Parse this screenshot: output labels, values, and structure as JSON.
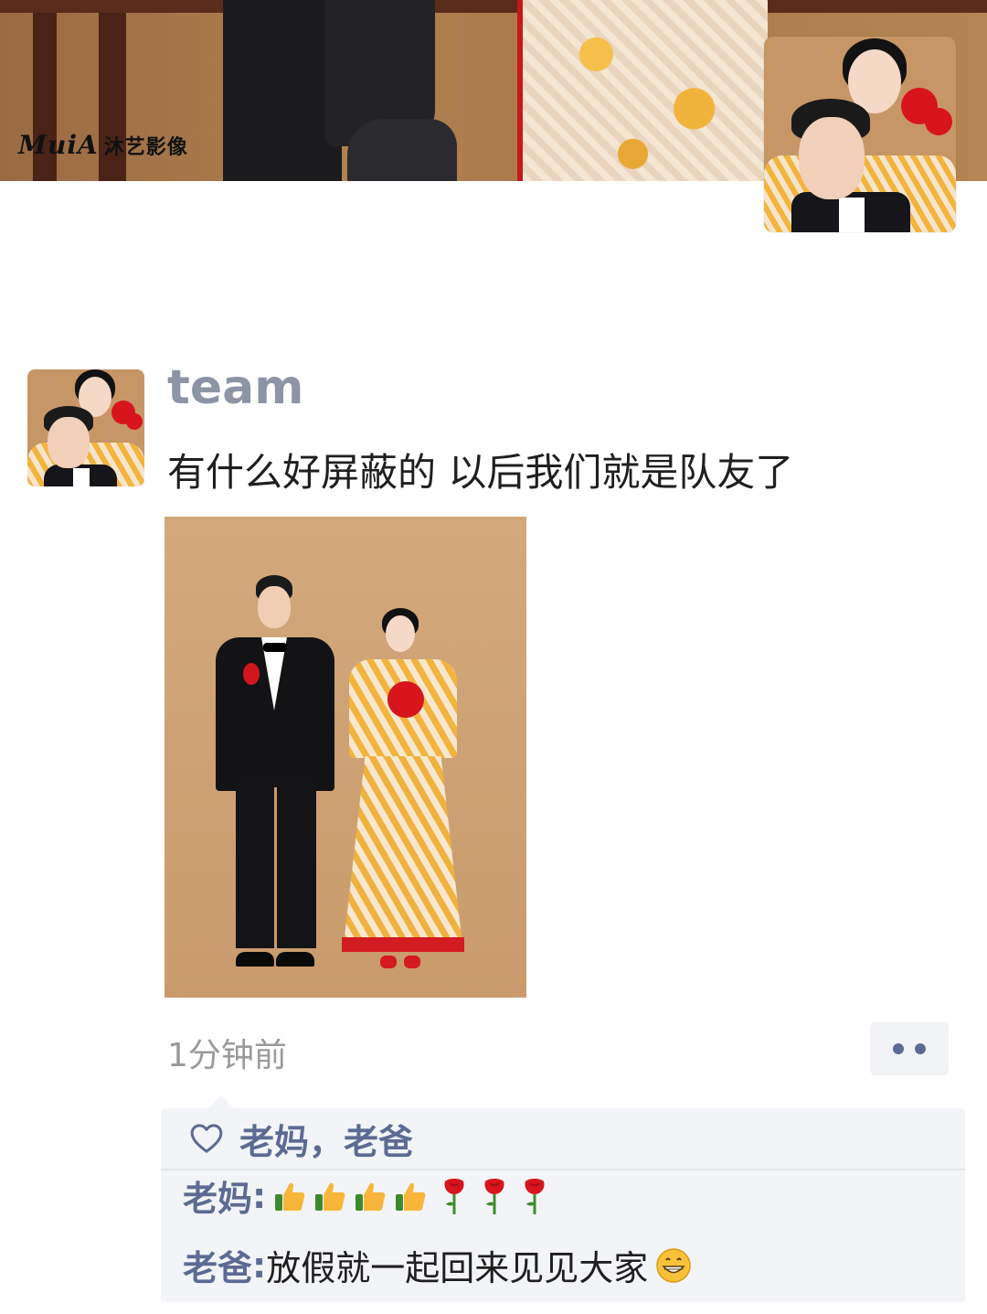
{
  "cover": {
    "logo_latin": "MuiA",
    "logo_cn": "沐艺影像"
  },
  "post": {
    "username": "team",
    "text": "有什么好屏蔽的 以后我们就是队友了",
    "timestamp": "1分钟前"
  },
  "interactions": {
    "likes": "老妈，老爸",
    "comments": [
      {
        "author": "老妈",
        "separator": ": ",
        "text": ""
      },
      {
        "author": "老爸",
        "separator": ": ",
        "text": "放假就一起回来见见大家"
      }
    ]
  },
  "colors": {
    "link_blue": "#5c6b93",
    "username_gray": "#8d94a6",
    "panel_bg": "#f3f4f7"
  },
  "icons": [
    "heart-icon",
    "more-icon",
    "thumbs-up-icon",
    "rose-icon",
    "grinning-icon"
  ]
}
